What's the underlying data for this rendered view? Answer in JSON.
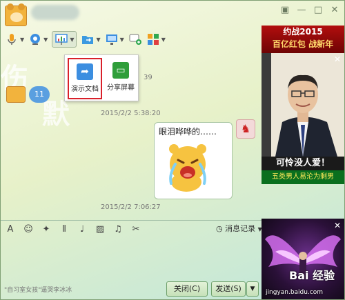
{
  "title_bar": {
    "window_controls": [
      {
        "icon": "skin-icon",
        "glyph": "▣"
      },
      {
        "icon": "minimize-icon",
        "glyph": "—"
      },
      {
        "icon": "maximize-icon",
        "glyph": "□"
      },
      {
        "icon": "close-icon",
        "glyph": "✕"
      }
    ]
  },
  "dropdown": {
    "items": [
      {
        "label": "演示文档",
        "icon": "present-doc-icon",
        "color": "#3c8ee0",
        "selected": true
      },
      {
        "label": "分享屏幕",
        "icon": "share-screen-icon",
        "color": "#2f9e3a",
        "selected": false
      }
    ]
  },
  "calligraphy": {
    "left": "伤",
    "bottom": "默"
  },
  "chat": {
    "partial_time": "39",
    "badge_count": "11",
    "messages": [
      {
        "time": "2015/2/2 5:38:20",
        "text": "眼泪哗哗的……"
      },
      {
        "time": "2015/2/2 7:06:27"
      }
    ]
  },
  "bottom_toolbar": {
    "tools": [
      {
        "icon": "font-icon",
        "glyph": "A"
      },
      {
        "icon": "emoji-icon",
        "glyph": "☺"
      },
      {
        "icon": "magic-wand-icon",
        "glyph": "✦"
      },
      {
        "icon": "shake-icon",
        "glyph": "⦀"
      },
      {
        "icon": "voice-icon",
        "glyph": "♩"
      },
      {
        "icon": "picture-icon",
        "glyph": "▨"
      },
      {
        "icon": "music-icon",
        "glyph": "♫"
      },
      {
        "icon": "screenshot-icon",
        "glyph": "✂"
      }
    ],
    "history_label": "消息记录"
  },
  "footer": {
    "hint": "\"自习室女孩\"逼哭李冰冰",
    "close_label": "关闭(C)",
    "send_label": "发送(S)",
    "arrow": "▼"
  },
  "ads": {
    "top": {
      "line1": "约战2015",
      "line2": "百亿红包 战新年",
      "caption1": "可怜没人爱！",
      "caption2": "五类男人易沦为剩男"
    },
    "bottom": {
      "watermark": "Bai 经验",
      "watermark_url": "jingyan.baidu.com"
    },
    "close_glyph": "✕"
  },
  "colors": {
    "accent_green": "#6fa06a",
    "selection_red": "#d9202a",
    "bubble_border": "#a9c6a3",
    "ad_red": "#b20e0e",
    "ad_green": "#0a6f1e"
  }
}
